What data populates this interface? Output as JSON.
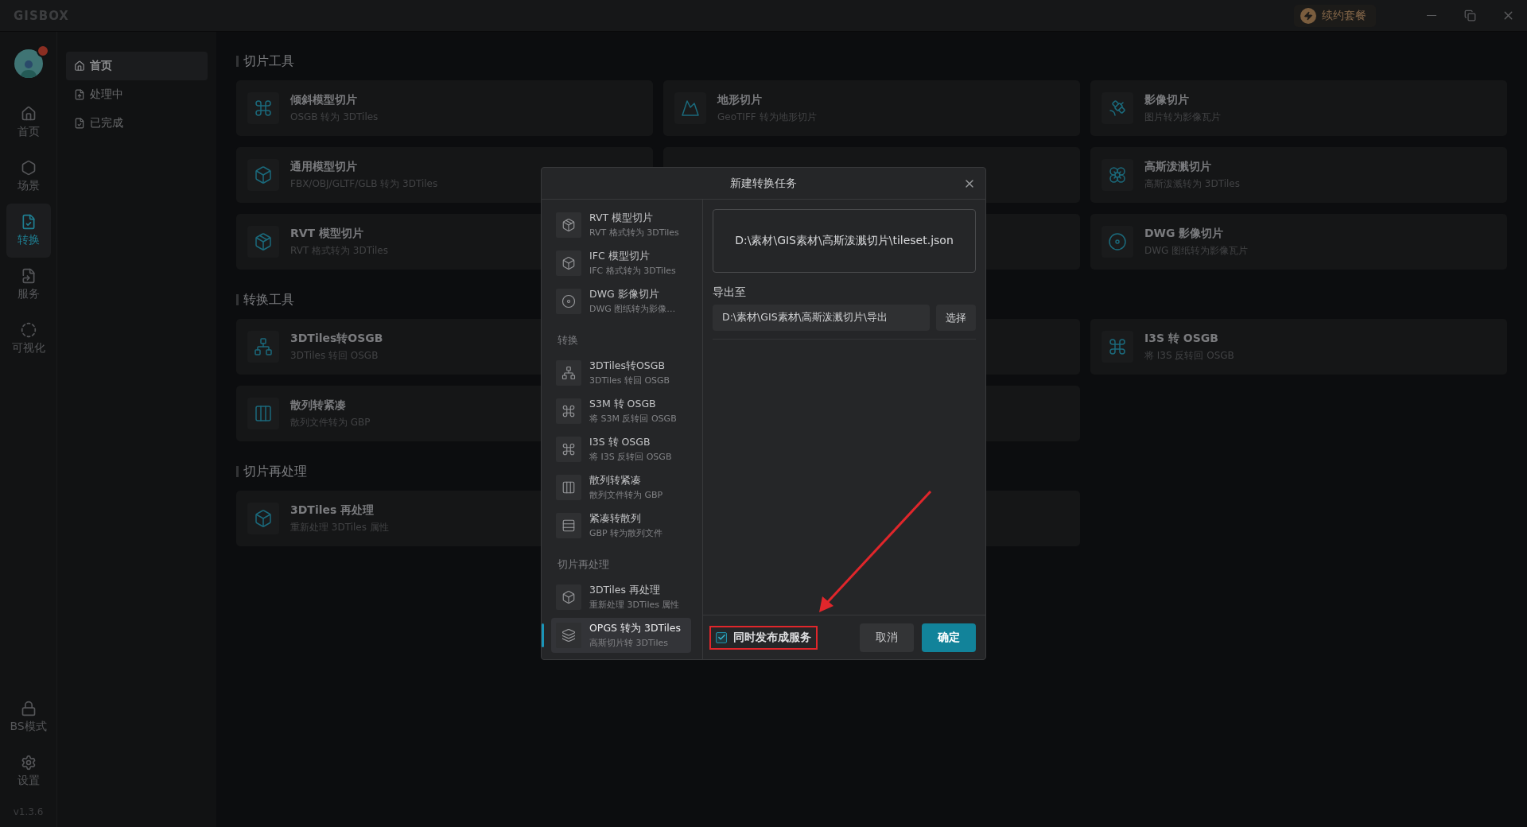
{
  "app": {
    "logo": "GISBOX",
    "renew_button": "续约套餐"
  },
  "rail": {
    "items": [
      {
        "label": "首页",
        "selected": false
      },
      {
        "label": "场景",
        "selected": false
      },
      {
        "label": "转换",
        "selected": true
      },
      {
        "label": "服务",
        "selected": false
      },
      {
        "label": "可视化",
        "selected": false
      }
    ],
    "bottom_items": [
      {
        "label": "BS模式"
      },
      {
        "label": "设置"
      }
    ],
    "version": "v1.3.6"
  },
  "nav": {
    "items": [
      {
        "label": "首页",
        "selected": true
      },
      {
        "label": "处理中",
        "selected": false
      },
      {
        "label": "已完成",
        "selected": false
      }
    ]
  },
  "sections": [
    {
      "title": "切片工具",
      "cards": [
        {
          "kind": "tool",
          "title": "倾斜模型切片",
          "subtitle": "OSGB 转为 3DTiles"
        },
        {
          "kind": "tool",
          "title": "地形切片",
          "subtitle": "GeoTIFF 转为地形切片"
        },
        {
          "kind": "tool",
          "title": "影像切片",
          "subtitle": "图片转为影像瓦片"
        },
        {
          "kind": "tool",
          "title": "通用模型切片",
          "subtitle": "FBX/OBJ/GLTF/GLB 转为 3DTiles"
        },
        {
          "kind": "covered"
        },
        {
          "kind": "tool",
          "title": "高斯泼溅切片",
          "subtitle": "高斯泼溅转为 3DTiles"
        },
        {
          "kind": "tool",
          "title": "RVT 模型切片",
          "subtitle": "RVT 格式转为 3DTiles"
        },
        {
          "kind": "covered"
        },
        {
          "kind": "tool",
          "title": "DWG 影像切片",
          "subtitle": "DWG 图纸转为影像瓦片"
        }
      ]
    },
    {
      "title": "转换工具",
      "cards": [
        {
          "kind": "tool",
          "title": "3DTiles转OSGB",
          "subtitle": "3DTiles 转回 OSGB"
        },
        {
          "kind": "covered"
        },
        {
          "kind": "tool",
          "title": "I3S 转 OSGB",
          "subtitle": "将 I3S 反转回 OSGB"
        },
        {
          "kind": "tool",
          "title": "散列转紧凑",
          "subtitle": "散列文件转为 GBP"
        },
        {
          "kind": "covered"
        }
      ]
    },
    {
      "title": "切片再处理",
      "cards": [
        {
          "kind": "tool",
          "title": "3DTiles 再处理",
          "subtitle": "重新处理 3DTiles 属性"
        },
        {
          "kind": "covered"
        }
      ]
    }
  ],
  "dialog": {
    "title": "新建转换任务",
    "groups": [
      {
        "items": [
          {
            "title": "RVT 模型切片",
            "subtitle": "RVT 格式转为 3DTiles",
            "selected": false
          },
          {
            "title": "IFC 模型切片",
            "subtitle": "IFC 格式转为 3DTiles",
            "selected": false
          },
          {
            "title": "DWG 影像切片",
            "subtitle": "DWG 图纸转为影像…",
            "selected": false
          }
        ]
      },
      {
        "heading": "转换",
        "items": [
          {
            "title": "3DTiles转OSGB",
            "subtitle": "3DTiles 转回 OSGB",
            "selected": false
          },
          {
            "title": "S3M 转 OSGB",
            "subtitle": "将 S3M 反转回 OSGB",
            "selected": false
          },
          {
            "title": "I3S 转 OSGB",
            "subtitle": "将 I3S 反转回 OSGB",
            "selected": false
          },
          {
            "title": "散列转紧凑",
            "subtitle": "散列文件转为 GBP",
            "selected": false
          },
          {
            "title": "紧凑转散列",
            "subtitle": "GBP 转为散列文件",
            "selected": false
          }
        ]
      },
      {
        "heading": "切片再处理",
        "items": [
          {
            "title": "3DTiles 再处理",
            "subtitle": "重新处理 3DTiles 属性",
            "selected": false
          },
          {
            "title": "OPGS 转为 3DTiles",
            "subtitle": "高斯切片转 3DTiles",
            "selected": true
          }
        ]
      }
    ],
    "source_file": "D:\\素材\\GIS素材\\高斯泼溅切片\\tileset.json",
    "output_label": "导出至",
    "output_path": "D:\\素材\\GIS素材\\高斯泼溅切片\\导出",
    "choose_button": "选择",
    "publish": {
      "label": "同时发布成服务",
      "checked": true
    },
    "cancel_button": "取消",
    "confirm_button": "确定"
  }
}
